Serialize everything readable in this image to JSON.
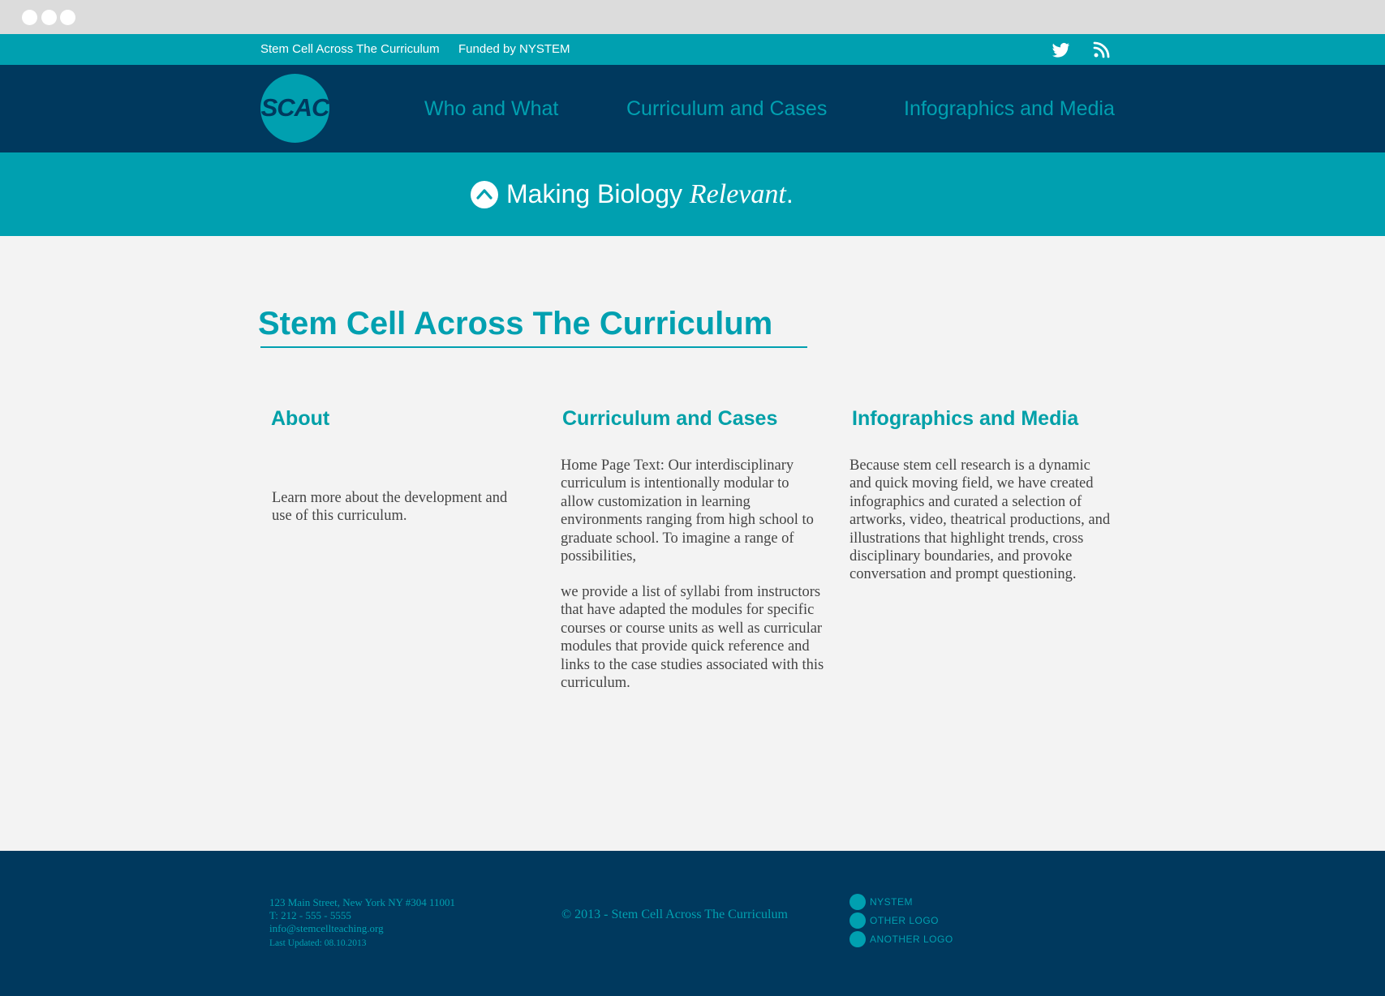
{
  "top_bar": {
    "site_title": "Stem Cell Across The Curriculum",
    "funded_by": "Funded by NYSTEM",
    "social_icons": [
      "twitter-icon",
      "rss-icon"
    ]
  },
  "logo": {
    "text": "SCAC"
  },
  "nav": {
    "items": [
      {
        "label": "Who and What"
      },
      {
        "label": "Curriculum and Cases"
      },
      {
        "label": "Infographics and Media"
      }
    ]
  },
  "tagline": {
    "prefix": "Making Biology ",
    "emphasis": "Relevant",
    "suffix": ".",
    "icon": "chevron-up-icon"
  },
  "main": {
    "title": "Stem Cell Across The Curriculum",
    "columns": [
      {
        "heading": "About",
        "paragraphs": [
          "Learn more about the development and use of this curriculum."
        ]
      },
      {
        "heading": "Curriculum and Cases",
        "paragraphs": [
          "Home Page Text: Our interdisciplinary curriculum is intentionally modular to allow customization in learning environments ranging from high school to graduate school. To imagine a range of possibilities,",
          "we provide a list of syllabi from instructors that have adapted the modules for specific courses or course units  as well as  curricular modules that provide quick reference and links to the case studies associated with this curriculum."
        ]
      },
      {
        "heading": "Infographics and Media",
        "paragraphs": [
          "Because stem cell research is a dynamic and quick moving field, we have created infographics and curated a selection of artworks, video, theatrical productions, and illustrations  that highlight trends, cross disciplinary boundaries, and provoke conversation and prompt questioning."
        ]
      }
    ]
  },
  "footer": {
    "address": "123 Main Street, New York NY #304 11001",
    "phone": "T: 212 - 555 - 5555",
    "email": "info@stemcellteaching.org",
    "last_updated": "Last Updated: 08.10.2013",
    "copyright": "© 2013 - Stem Cell Across The Curriculum",
    "logos": [
      "nystem",
      "other logo",
      "another logo"
    ]
  },
  "colors": {
    "teal": "#00a0b0",
    "navy": "#00395e",
    "background": "#f3f3f3",
    "chrome": "#dcdcdc",
    "body_text": "#444444"
  }
}
